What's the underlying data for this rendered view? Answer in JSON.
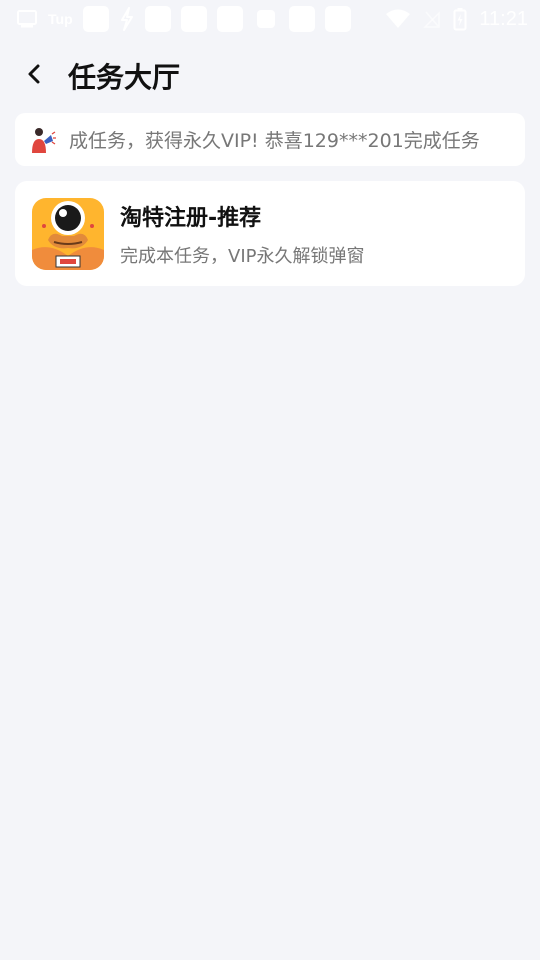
{
  "status_bar": {
    "carrier_label": "Tup",
    "time": "11:21"
  },
  "header": {
    "back_icon": "chevron-left-icon",
    "title": "任务大厅"
  },
  "notice": {
    "icon": "announcer-icon",
    "text": "成任务，获得永久VIP!  恭喜129***201完成任务"
  },
  "tasks": [
    {
      "logo_icon": "taote-app-logo",
      "logo_color": "#ffb52e",
      "title": "淘特注册-推荐",
      "description": "完成本任务，VIP永久解锁弹窗"
    }
  ],
  "colors": {
    "background": "#f4f5f9",
    "card": "#ffffff",
    "title_text": "#111111",
    "secondary_text": "#777777"
  }
}
